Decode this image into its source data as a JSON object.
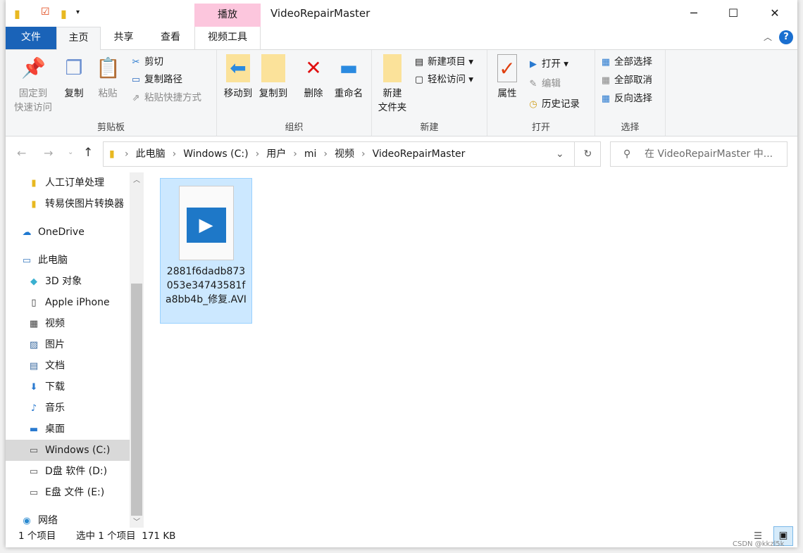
{
  "title": "VideoRepairMaster",
  "context_tab": "播放",
  "window_controls": {
    "minimize": "─",
    "maximize": "☐",
    "close": "✕"
  },
  "tabs": [
    "文件",
    "主页",
    "共享",
    "查看",
    "视频工具"
  ],
  "ribbon": {
    "clipboard": {
      "label": "剪贴板",
      "pin": "固定到\n快速访问",
      "copy": "复制",
      "paste": "粘贴",
      "cut": "剪切",
      "copy_path": "复制路径",
      "paste_shortcut": "粘贴快捷方式"
    },
    "organize": {
      "label": "组织",
      "move_to": "移动到",
      "copy_to": "复制到",
      "delete": "删除",
      "rename": "重命名"
    },
    "new": {
      "label": "新建",
      "new_folder": "新建\n文件夹",
      "new_item": "新建项目",
      "easy_access": "轻松访问"
    },
    "open": {
      "label": "打开",
      "properties": "属性",
      "open": "打开",
      "edit": "编辑",
      "history": "历史记录"
    },
    "select": {
      "label": "选择",
      "select_all": "全部选择",
      "select_none": "全部取消",
      "invert": "反向选择"
    }
  },
  "address": {
    "crumbs": [
      "此电脑",
      "Windows (C:)",
      "用户",
      "mi",
      "视频",
      "VideoRepairMaster"
    ]
  },
  "search": {
    "placeholder": "在 VideoRepairMaster 中..."
  },
  "nav": [
    {
      "label": "人工订单处理",
      "icon": "folder-icon"
    },
    {
      "label": "转易侠图片转换器",
      "icon": "folder-icon"
    },
    {
      "label": "OneDrive",
      "icon": "cloud-icon"
    },
    {
      "label": "此电脑",
      "icon": "computer-icon"
    },
    {
      "label": "3D 对象",
      "icon": "cube-icon"
    },
    {
      "label": "Apple iPhone",
      "icon": "phone-icon"
    },
    {
      "label": "视频",
      "icon": "film-icon"
    },
    {
      "label": "图片",
      "icon": "picture-icon"
    },
    {
      "label": "文档",
      "icon": "document-icon"
    },
    {
      "label": "下载",
      "icon": "download-icon"
    },
    {
      "label": "音乐",
      "icon": "music-icon"
    },
    {
      "label": "桌面",
      "icon": "desktop-icon"
    },
    {
      "label": "Windows (C:)",
      "icon": "drive-icon"
    },
    {
      "label": "D盘 软件 (D:)",
      "icon": "drive-icon"
    },
    {
      "label": "E盘 文件 (E:)",
      "icon": "drive-icon"
    },
    {
      "label": "网络",
      "icon": "network-icon"
    }
  ],
  "file": {
    "name": "2881f6dadb873053e34743581fa8bb4b_修复.AVI"
  },
  "status": {
    "count": "1 个项目",
    "selected": "选中 1 个项目  171 KB"
  },
  "watermark": "CSDN @kkzl5k"
}
